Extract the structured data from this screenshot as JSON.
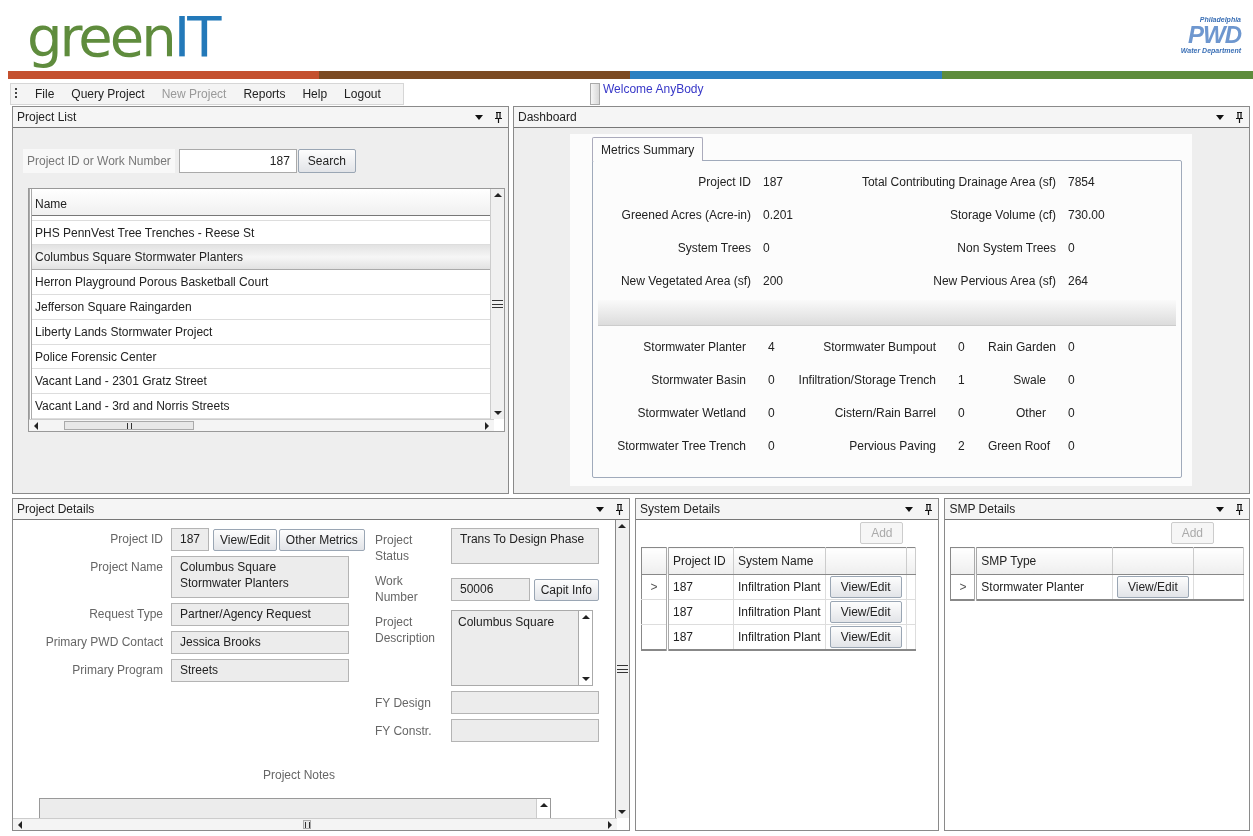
{
  "logo": {
    "first": "green",
    "second": "IT"
  },
  "agency_logo": {
    "top": "Philadelphia",
    "mark": "PWD",
    "bottom": "Water Department"
  },
  "menu": [
    {
      "label": "File",
      "disabled": false
    },
    {
      "label": "Query Project",
      "disabled": false
    },
    {
      "label": "New Project",
      "disabled": true
    },
    {
      "label": "Reports",
      "disabled": false
    },
    {
      "label": "Help",
      "disabled": false
    },
    {
      "label": "Logout",
      "disabled": false
    }
  ],
  "welcome": "Welcome AnyBody",
  "project_list": {
    "title": "Project List",
    "search_label": "Project ID or Work Number",
    "search_value": "187",
    "search_button": "Search",
    "column": "Name",
    "rows": [
      {
        "name": "PHS PennVest Tree Trenches - Reese St",
        "selected": false
      },
      {
        "name": "Columbus Square Stormwater Planters",
        "selected": true
      },
      {
        "name": "Herron Playground Porous Basketball Court",
        "selected": false
      },
      {
        "name": "Jefferson Square Raingarden",
        "selected": false
      },
      {
        "name": "Liberty Lands Stormwater Project",
        "selected": false
      },
      {
        "name": "Police Forensic Center",
        "selected": false
      },
      {
        "name": "Vacant Land - 2301 Gratz Street",
        "selected": false
      },
      {
        "name": "Vacant Land - 3rd and Norris Streets",
        "selected": false
      }
    ]
  },
  "dashboard": {
    "title": "Dashboard",
    "tabs": [
      {
        "label": "Metrics Summary",
        "selected": true
      }
    ],
    "metrics": [
      {
        "label": "Project ID",
        "value": "187"
      },
      {
        "label": "Total Contributing Drainage Area (sf)",
        "value": "7854"
      },
      {
        "label": "Greened Acres (Acre-in)",
        "value": "0.201"
      },
      {
        "label": "Storage Volume (cf)",
        "value": "730.00"
      },
      {
        "label": "System Trees",
        "value": "0"
      },
      {
        "label": "Non System Trees",
        "value": "0"
      },
      {
        "label": "New Vegetated Area (sf)",
        "value": "200"
      },
      {
        "label": "New Pervious Area (sf)",
        "value": "264"
      }
    ],
    "smp_counts": [
      {
        "label": "Stormwater Planter",
        "value": "4"
      },
      {
        "label": "Stormwater Bumpout",
        "value": "0"
      },
      {
        "label": "Rain Garden",
        "value": "0"
      },
      {
        "label": "Stormwater Basin",
        "value": "0"
      },
      {
        "label": "Infiltration/Storage Trench",
        "value": "1"
      },
      {
        "label": "Swale",
        "value": "0"
      },
      {
        "label": "Stormwater Wetland",
        "value": "0"
      },
      {
        "label": "Cistern/Rain Barrel",
        "value": "0"
      },
      {
        "label": "Other",
        "value": "0"
      },
      {
        "label": "Stormwater Tree Trench",
        "value": "0"
      },
      {
        "label": "Pervious Paving",
        "value": "2"
      },
      {
        "label": "Green Roof",
        "value": "0"
      }
    ]
  },
  "project_details": {
    "title": "Project Details",
    "project_id": {
      "label": "Project ID",
      "value": "187"
    },
    "buttons": [
      "View/Edit",
      "Other Metrics"
    ],
    "left_fields": [
      {
        "label": "Project Name",
        "value": "Columbus Square Stormwater Planters"
      },
      {
        "label": "Request Type",
        "value": "Partner/Agency Request"
      },
      {
        "label": "Primary PWD Contact",
        "value": "Jessica Brooks"
      },
      {
        "label": "Primary Program",
        "value": "Streets"
      }
    ],
    "project_status": {
      "label": "Project Status",
      "value": "Trans To Design Phase"
    },
    "work_number": {
      "label": "Work Number",
      "value": "50006",
      "button": "Capit Info"
    },
    "description": {
      "label": "Project Description",
      "value": "Columbus Square"
    },
    "fy_fields": [
      {
        "label": "FY Design"
      },
      {
        "label": "FY Constr."
      }
    ],
    "notes_label": "Project Notes"
  },
  "system_details": {
    "title": "System Details",
    "add_button": {
      "label": "Add",
      "disabled": true
    },
    "columns": [
      "Project ID",
      "System Name"
    ],
    "rows": [
      {
        "marker": ">",
        "cells": [
          "187",
          "Infiltration Plant"
        ],
        "action": "View/Edit"
      },
      {
        "cells": [
          "187",
          "Infiltration Plant"
        ],
        "action": "View/Edit"
      },
      {
        "cells": [
          "187",
          "Infiltration Plant"
        ],
        "action": "View/Edit"
      }
    ]
  },
  "smp_details": {
    "title": "SMP Details",
    "add_button": {
      "label": "Add",
      "disabled": true
    },
    "columns": [
      "SMP Type"
    ],
    "rows": [
      {
        "marker": ">",
        "cells": [
          "Stormwater Planter"
        ],
        "action": "View/Edit"
      }
    ]
  }
}
